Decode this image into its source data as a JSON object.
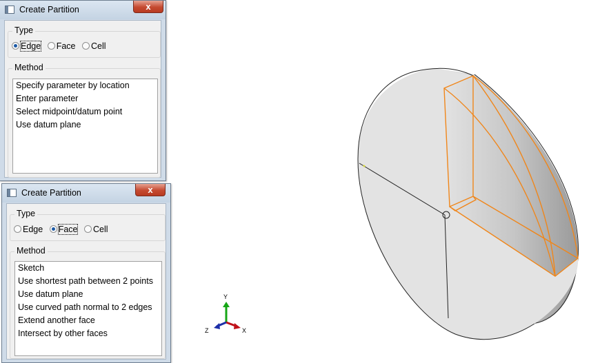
{
  "edge_dialog": {
    "title": "Create Partition",
    "close_label": "x",
    "type_label": "Type",
    "type_options": [
      "Edge",
      "Face",
      "Cell"
    ],
    "selected_type": "Edge",
    "method_label": "Method",
    "methods": [
      "Specify parameter by location",
      "Enter parameter",
      "Select midpoint/datum point",
      "Use datum plane"
    ]
  },
  "face_dialog": {
    "title": "Create Partition",
    "close_label": "x",
    "type_label": "Type",
    "type_options": [
      "Edge",
      "Face",
      "Cell"
    ],
    "selected_type": "Face",
    "method_label": "Method",
    "methods": [
      "Sketch",
      "Use shortest path between 2 points",
      "Use datum plane",
      "Use curved path normal to 2 edges",
      "Extend another face",
      "Intersect by other faces"
    ]
  },
  "triad": {
    "y_label": "Y",
    "x_label": "X",
    "z_label": "Z",
    "y_color": "#16a616",
    "x_color": "#c0121a",
    "z_color": "#1c2fa8"
  },
  "model": {
    "highlight_color": "#f0861a",
    "edge_color": "#222222"
  }
}
